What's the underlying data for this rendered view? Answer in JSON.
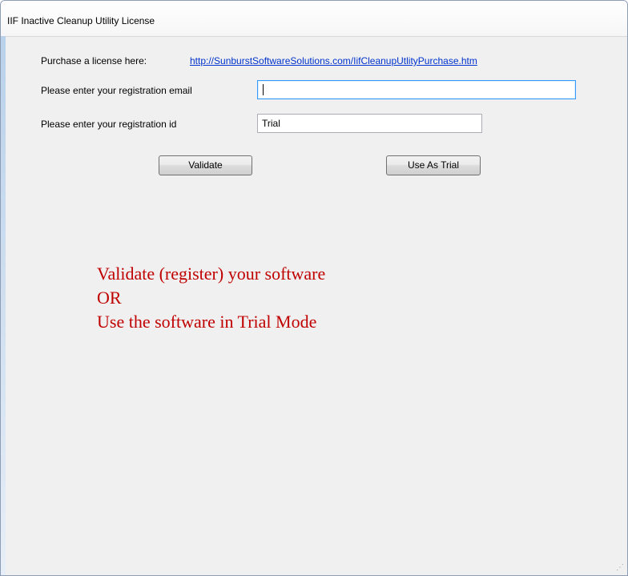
{
  "window": {
    "title": "IIF Inactive Cleanup Utility License"
  },
  "purchase": {
    "label": "Purchase a license here:",
    "link_text": "http://SunburstSoftwareSolutions.com/IifCleanupUtlityPurchase.htm"
  },
  "email": {
    "label": "Please enter your registration email",
    "value": ""
  },
  "regid": {
    "label": "Please enter your registration id",
    "value": "Trial"
  },
  "buttons": {
    "validate": "Validate",
    "trial": "Use As Trial"
  },
  "message": {
    "line1": "Validate (register) your software",
    "line2": "OR",
    "line3": "Use the software in Trial Mode"
  },
  "colors": {
    "message": "#c00000",
    "link": "#0033cc"
  },
  "icons": {
    "resize_grip": "resize-grip-icon"
  }
}
